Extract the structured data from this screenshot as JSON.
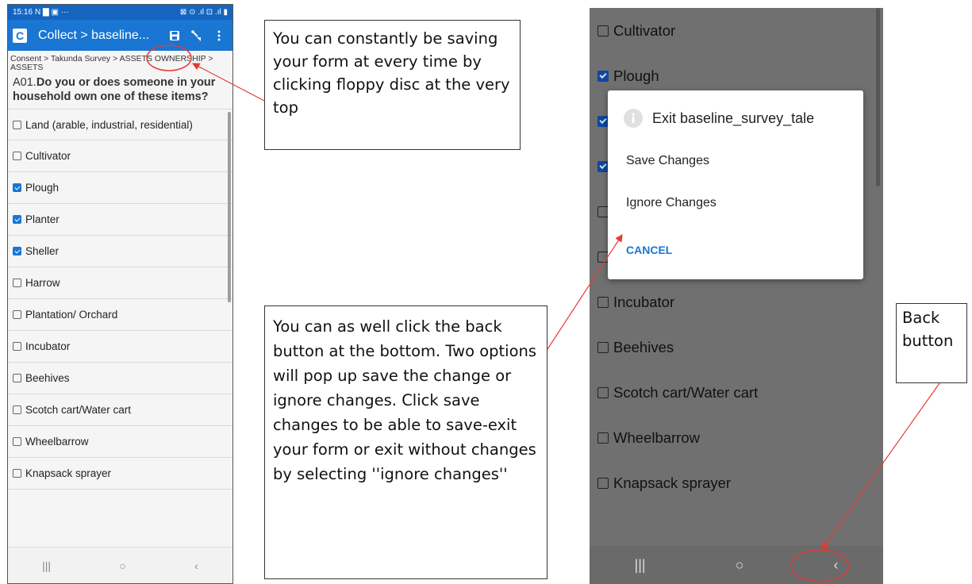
{
  "left_phone": {
    "status": {
      "time": "15:16",
      "left_extra": "N ▇ ▣ ···",
      "right_icons": "⊠ ⊙ .ıl ⊡ .ıl ▮"
    },
    "app_bar": {
      "logo": "C",
      "title": "Collect > baseline...",
      "save_icon": "floppy-disc-icon",
      "jump_icon": "jump-icon",
      "menu_icon": "more-vert-icon"
    },
    "breadcrumb": "Consent > Takunda Survey > ASSETS OWNERSHIP > ASSETS",
    "question_code": "A01.",
    "question_text": "Do you or does someone in your household own one of these items?",
    "options": [
      {
        "label": "Land (arable, industrial, residential)",
        "checked": false
      },
      {
        "label": "Cultivator",
        "checked": false
      },
      {
        "label": "Plough",
        "checked": true
      },
      {
        "label": "Planter",
        "checked": true
      },
      {
        "label": "Sheller",
        "checked": true
      },
      {
        "label": "Harrow",
        "checked": false
      },
      {
        "label": "Plantation/ Orchard",
        "checked": false
      },
      {
        "label": "Incubator",
        "checked": false
      },
      {
        "label": "Beehives",
        "checked": false
      },
      {
        "label": "Scotch cart/Water cart",
        "checked": false
      },
      {
        "label": "Wheelbarrow",
        "checked": false
      },
      {
        "label": "Knapsack sprayer",
        "checked": false
      }
    ],
    "nav": {
      "recents": "|||",
      "home": "○",
      "back": "‹"
    }
  },
  "callouts": {
    "save_tip": "You can constantly be saving your form at every time by clicking floppy disc at the very top",
    "back_tip": "You can as well click the back button at the bottom. Two options will pop up save the change or ignore changes. Click save changes to be able to save-exit your form or exit without changes by selecting ''ignore changes''",
    "back_label": "Back button"
  },
  "right_phone": {
    "options": [
      {
        "label": "Cultivator",
        "checked": false
      },
      {
        "label": "Plough",
        "checked": true
      },
      {
        "label": "",
        "checked": true
      },
      {
        "label": "",
        "checked": true
      },
      {
        "label": "",
        "checked": false
      },
      {
        "label": "",
        "checked": false
      },
      {
        "label": "Incubator",
        "checked": false
      },
      {
        "label": "Beehives",
        "checked": false
      },
      {
        "label": "Scotch cart/Water cart",
        "checked": false
      },
      {
        "label": "Wheelbarrow",
        "checked": false
      },
      {
        "label": "Knapsack sprayer",
        "checked": false
      }
    ],
    "dialog": {
      "title": "Exit baseline_survey_tale",
      "save": "Save Changes",
      "ignore": "Ignore Changes",
      "cancel": "CANCEL"
    },
    "nav": {
      "recents": "|||",
      "home": "○",
      "back": "‹"
    }
  },
  "colors": {
    "app_bar": "#1976d2",
    "annotation": "#e53935",
    "accent": "#1976d2"
  }
}
